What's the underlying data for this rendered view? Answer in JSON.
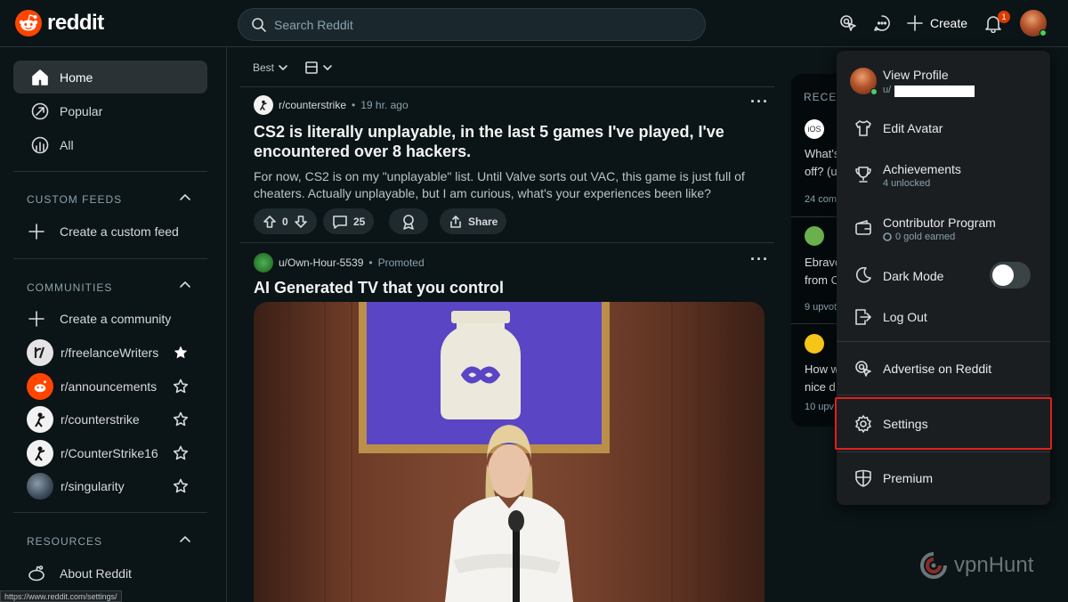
{
  "header": {
    "logo_text": "reddit",
    "search_placeholder": "Search Reddit",
    "create_label": "Create",
    "notification_count": "1"
  },
  "sidebar": {
    "nav": [
      {
        "label": "Home",
        "icon": "home-icon"
      },
      {
        "label": "Popular",
        "icon": "popular-icon"
      },
      {
        "label": "All",
        "icon": "all-icon"
      }
    ],
    "custom_feeds": {
      "title": "CUSTOM FEEDS",
      "create_label": "Create a custom feed"
    },
    "communities": {
      "title": "COMMUNITIES",
      "create_label": "Create a community",
      "items": [
        {
          "name": "r/freelanceWriters",
          "starred": true
        },
        {
          "name": "r/announcements",
          "starred": false
        },
        {
          "name": "r/counterstrike",
          "starred": false
        },
        {
          "name": "r/CounterStrike16",
          "starred": false
        },
        {
          "name": "r/singularity",
          "starred": false
        }
      ]
    },
    "resources": {
      "title": "RESOURCES",
      "about_label": "About Reddit"
    }
  },
  "feed": {
    "sort_label": "Best",
    "post1": {
      "subreddit": "r/counterstrike",
      "time": "19 hr. ago",
      "title": "CS2 is literally unplayable, in the last 5 games I've played, I've encountered over 8 hackers.",
      "body": "For now, CS2 is on my \"unplayable\" list. Until Valve sorts out VAC, this game is just full of cheaters. Actually unplayable, but I am curious, what's your experiences been like?",
      "votes": "0",
      "comments": "25",
      "share_label": "Share"
    },
    "post2": {
      "user": "u/Own-Hour-5539",
      "tag": "Promoted",
      "title": "AI Generated TV that you control"
    }
  },
  "recent": {
    "title": "RECENT",
    "items": [
      {
        "line1": "What's",
        "line2": "off? (u",
        "meta": "24 com"
      },
      {
        "line1": "Ebravo",
        "line2": "from C",
        "meta": "9 upvot"
      },
      {
        "line1": "How w",
        "line2": "nice d",
        "meta": "10 upv"
      }
    ]
  },
  "profile_menu": {
    "view_profile": "View Profile",
    "username_prefix": "u/",
    "edit_avatar": "Edit Avatar",
    "achievements": "Achievements",
    "achievements_sub": "4 unlocked",
    "contributor": "Contributor Program",
    "contributor_sub": "0 gold earned",
    "dark_mode": "Dark Mode",
    "log_out": "Log Out",
    "advertise": "Advertise on Reddit",
    "settings": "Settings",
    "premium": "Premium"
  },
  "status_url": "https://www.reddit.com/settings/",
  "watermark": "vpnHunt",
  "colors": {
    "background": "#0b1416",
    "reddit_orange": "#ff4500",
    "highlight": "#e0201e",
    "badge": "#d93a00"
  }
}
